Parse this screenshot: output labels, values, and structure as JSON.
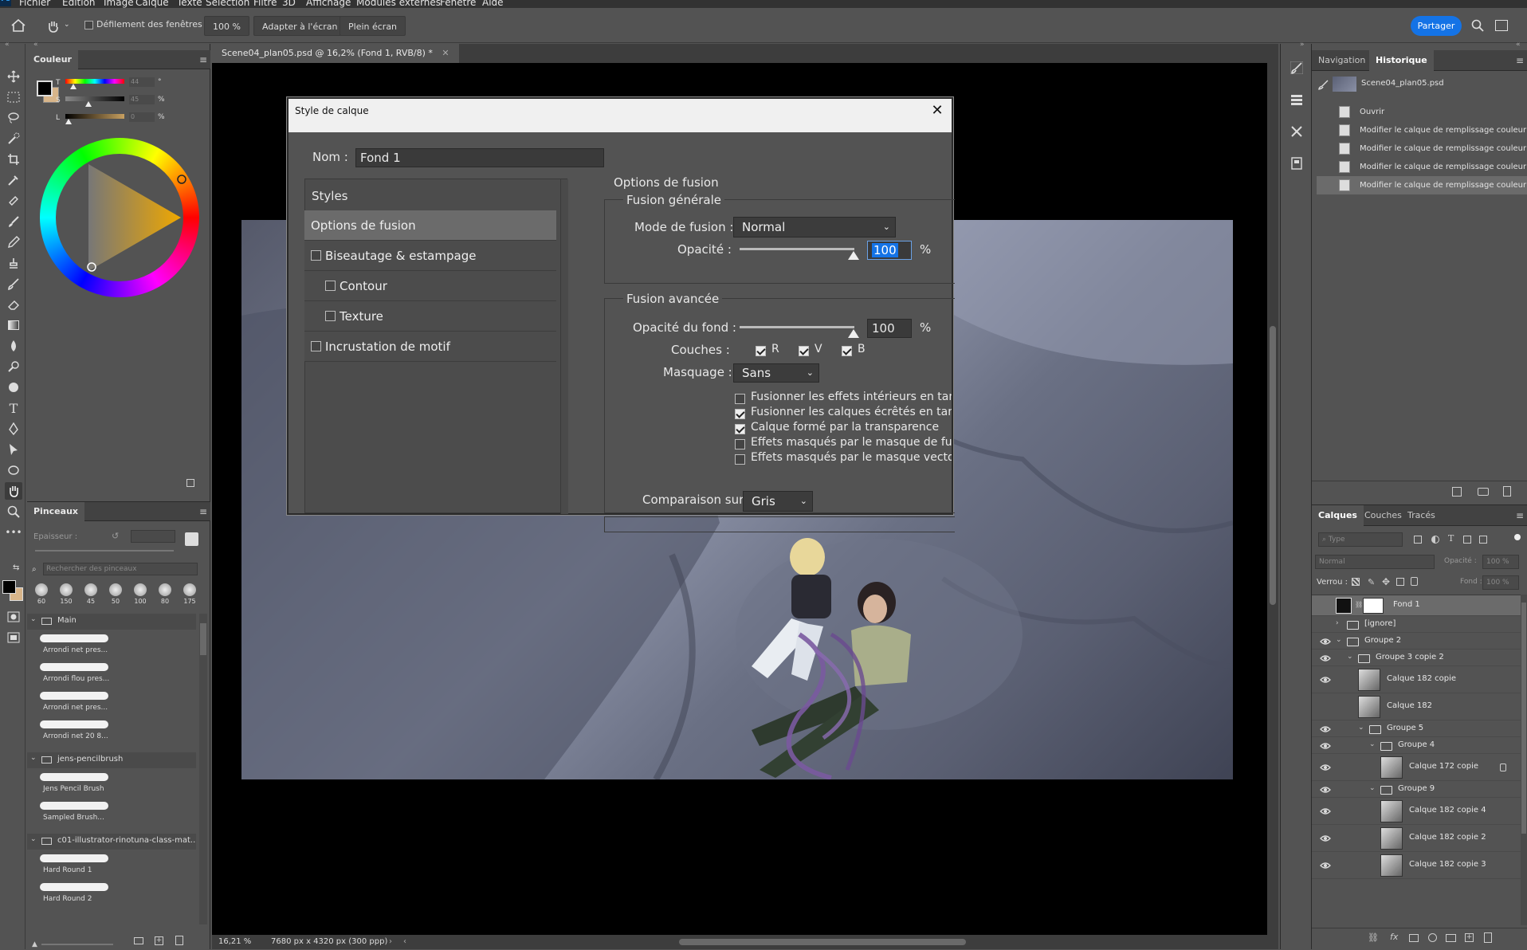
{
  "menu": {
    "items": [
      "Fichier",
      "Edition",
      "Image",
      "Calque",
      "Texte",
      "Sélection",
      "Filtre",
      "3D",
      "Affichage",
      "Modules externes",
      "Fenêtre",
      "Aide"
    ]
  },
  "options_bar": {
    "scroll_windows_label": "Défilement des fenêtres",
    "zoom_btn": "100 %",
    "fit_btn": "Adapter à l'écran",
    "fullscreen_btn": "Plein écran",
    "share_btn": "Partager"
  },
  "color_panel": {
    "tab": "Couleur",
    "sliders": [
      {
        "label": "T",
        "value": "44",
        "unit": "°"
      },
      {
        "label": "S",
        "value": "45",
        "unit": "%"
      },
      {
        "label": "L",
        "value": "0",
        "unit": "%"
      }
    ]
  },
  "brushes_panel": {
    "tab": "Pinceaux",
    "size_label": "Epaisseur :",
    "search_placeholder": "Rechercher des pinceaux",
    "presets": [
      "60",
      "150",
      "45",
      "50",
      "100",
      "80",
      "175"
    ],
    "groups": [
      {
        "name": "Main",
        "brushes": [
          "Arrondi net pres...",
          "Arrondi flou pres...",
          "Arrondi net pres...",
          "Arrondi net 20 8..."
        ]
      },
      {
        "name": "jens-pencilbrush",
        "brushes": [
          "Jens Pencil Brush",
          "Sampled Brush..."
        ]
      },
      {
        "name": "c01-illustrator-rinotuna-class-mat...",
        "brushes": [
          "Hard Round 1",
          "Hard Round 2"
        ]
      }
    ]
  },
  "document": {
    "tab_title": "Scene04_plan05.psd @ 16,2% (Fond 1, RVB/8) *",
    "status_zoom": "16,21 %",
    "status_info": "7680 px x 4320 px (300 ppp)"
  },
  "dialog": {
    "title": "Style de calque",
    "name_label": "Nom :",
    "name_value": "Fond 1",
    "styles_header": "Styles",
    "style_items": [
      {
        "label": "Options de fusion",
        "checkbox": false,
        "selected": true,
        "indent": false
      },
      {
        "label": "Biseautage & estampage",
        "checkbox": true,
        "checked": false,
        "indent": false
      },
      {
        "label": "Contour",
        "checkbox": true,
        "checked": false,
        "indent": true
      },
      {
        "label": "Texture",
        "checkbox": true,
        "checked": false,
        "indent": true
      },
      {
        "label": "Incrustation de motif",
        "checkbox": true,
        "checked": false,
        "indent": false
      }
    ],
    "section_title": "Options de fusion",
    "general_title": "Fusion générale",
    "blend_mode_label": "Mode de fusion :",
    "blend_mode_value": "Normal",
    "opacity_label": "Opacité :",
    "opacity_value": "100",
    "percent": "%",
    "advanced_title": "Fusion avancée",
    "fill_opacity_label": "Opacité du fond :",
    "fill_opacity_value": "100",
    "channels_label": "Couches :",
    "channels": [
      {
        "name": "R",
        "checked": true
      },
      {
        "name": "V",
        "checked": true
      },
      {
        "name": "B",
        "checked": true
      }
    ],
    "knockout_label": "Masquage :",
    "knockout_value": "Sans",
    "options": [
      {
        "label": "Fusionner les effets intérieurs en tant c",
        "checked": false
      },
      {
        "label": "Fusionner les calques écrêtés en tant c",
        "checked": true
      },
      {
        "label": "Calque formé par la transparence",
        "checked": true
      },
      {
        "label": "Effets masqués par le masque de fusio",
        "checked": false
      },
      {
        "label": "Effets masqués par le masque vectorie",
        "checked": false
      }
    ],
    "compare_label": "Comparaison sur :",
    "compare_value": "Gris"
  },
  "history_panel": {
    "tabs": [
      "Navigation",
      "Historique"
    ],
    "snapshot": "Scene04_plan05.psd",
    "items": [
      "Ouvrir",
      "Modifier le calque de remplissage couleur",
      "Modifier le calque de remplissage couleur",
      "Modifier le calque de remplissage couleur",
      "Modifier le calque de remplissage couleur"
    ]
  },
  "layers_panel": {
    "tabs": [
      "Calques",
      "Couches",
      "Tracés"
    ],
    "filter_placeholder": "Type",
    "blend_mode": "Normal",
    "opacity_label": "Opacité :",
    "opacity_value": "100 %",
    "lock_label": "Verrou :",
    "fill_label": "Fond :",
    "fill_value": "100 %",
    "layers": [
      {
        "name": "Fond 1",
        "type": "fill",
        "visible": false,
        "indent": 0,
        "selected": true
      },
      {
        "name": "[ignore]",
        "type": "group",
        "visible": false,
        "indent": 0,
        "collapsed": true
      },
      {
        "name": "Groupe 2",
        "type": "group",
        "visible": true,
        "indent": 0
      },
      {
        "name": "Groupe 3 copie 2",
        "type": "group",
        "visible": true,
        "indent": 1
      },
      {
        "name": "Calque 182 copie",
        "type": "layer",
        "visible": true,
        "indent": 2
      },
      {
        "name": "Calque 182",
        "type": "layer",
        "visible": false,
        "indent": 2
      },
      {
        "name": "Groupe 5",
        "type": "group",
        "visible": true,
        "indent": 2
      },
      {
        "name": "Groupe 4",
        "type": "group",
        "visible": true,
        "indent": 3
      },
      {
        "name": "Calque 172 copie",
        "type": "layer",
        "visible": true,
        "indent": 4,
        "locked": true
      },
      {
        "name": "Groupe 9",
        "type": "group",
        "visible": true,
        "indent": 3
      },
      {
        "name": "Calque 182 copie 4",
        "type": "layer",
        "visible": true,
        "indent": 4
      },
      {
        "name": "Calque 182 copie 2",
        "type": "layer",
        "visible": true,
        "indent": 4
      },
      {
        "name": "Calque 182 copie 3",
        "type": "layer",
        "visible": true,
        "indent": 4
      }
    ]
  },
  "colors": {
    "accent": "#1473e6",
    "panel": "#535353",
    "dark": "#323232",
    "canvas": "#000000"
  }
}
